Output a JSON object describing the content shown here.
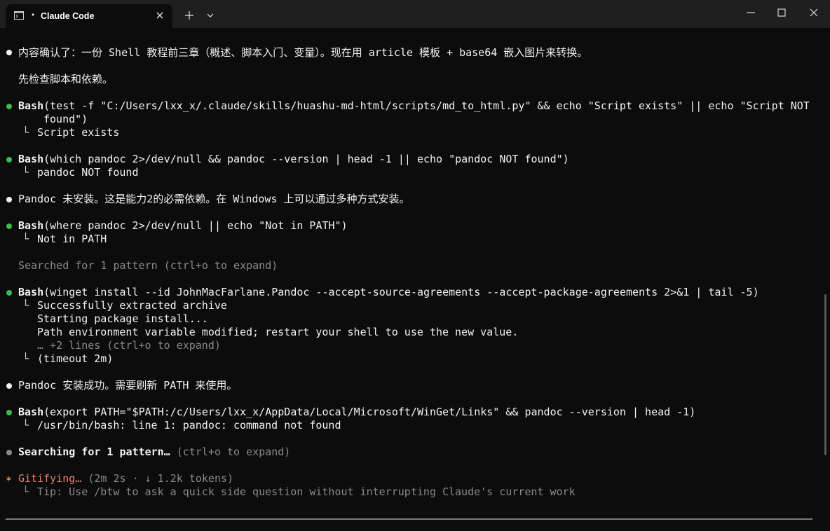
{
  "window": {
    "tab_title": "Claude Code",
    "tab_indicator": "•"
  },
  "colors": {
    "background": "#0c0c0c",
    "titlebar": "#1f1f1f",
    "text": "#cccccc",
    "success_dot": "#3fb950",
    "info_dot": "#f2f2f2",
    "muted": "#8a8a8a",
    "status_accent": "#e0826d"
  },
  "icons": {
    "terminal": "terminal-icon",
    "close": "close-icon",
    "new_tab": "plus-icon",
    "dropdown": "chevron-down-icon",
    "minimize": "minimize-icon",
    "maximize": "maximize-icon",
    "window_close": "window-close-icon",
    "bullet": "bullet-dot-icon",
    "tree_branch": "└",
    "status_spinner": "✶"
  },
  "terminal": {
    "messages": [
      {
        "text": "内容确认了：一份 Shell 教程前三章（概述、脚本入门、变量）。现在用 article 模板 + base64 嵌入图片来转换。"
      },
      {
        "text": "先检查脚本和依赖。"
      }
    ],
    "bash1": {
      "tool": "Bash",
      "command": "(test -f \"C:/Users/lxx_x/.claude/skills/huashu-md-html/scripts/md_to_html.py\" && echo \"Script exists\" || echo \"Script NOT",
      "command_wrap": "found\")",
      "output": "Script exists"
    },
    "bash2": {
      "tool": "Bash",
      "command": "(which pandoc 2>/dev/null && pandoc --version | head -1 || echo \"pandoc NOT found\")",
      "output": "pandoc NOT found"
    },
    "message2": "Pandoc 未安装。这是能力2的必需依赖。在 Windows 上可以通过多种方式安装。",
    "bash3": {
      "tool": "Bash",
      "command": "(where pandoc 2>/dev/null || echo \"Not in PATH\")",
      "output": "Not in PATH"
    },
    "search1": "Searched for 1 pattern (ctrl+o to expand)",
    "bash4": {
      "tool": "Bash",
      "command": "(winget install --id JohnMacFarlane.Pandoc --accept-source-agreements --accept-package-agreements 2>&1 | tail -5)",
      "output": [
        "Successfully extracted archive",
        "Starting package install...",
        "Path environment variable modified; restart your shell to use the new value."
      ],
      "more": "… +2 lines (ctrl+o to expand)",
      "timeout": "(timeout 2m)"
    },
    "message3": "Pandoc 安装成功。需要刷新 PATH 来使用。",
    "bash5": {
      "tool": "Bash",
      "command": "(export PATH=\"$PATH:/c/Users/lxx_x/AppData/Local/Microsoft/WinGet/Links\" && pandoc --version | head -1)",
      "output": "/usr/bin/bash: line 1: pandoc: command not found"
    },
    "search2": {
      "label": "Searching for 1 pattern…",
      "hint": "(ctrl+o to expand)"
    },
    "status": {
      "spinner": "✶",
      "verb": "Gitifying…",
      "detail": "(2m 2s · ↓ 1.2k tokens)",
      "tip": "Tip: Use /btw to ask a quick side question without interrupting Claude's current work"
    }
  }
}
